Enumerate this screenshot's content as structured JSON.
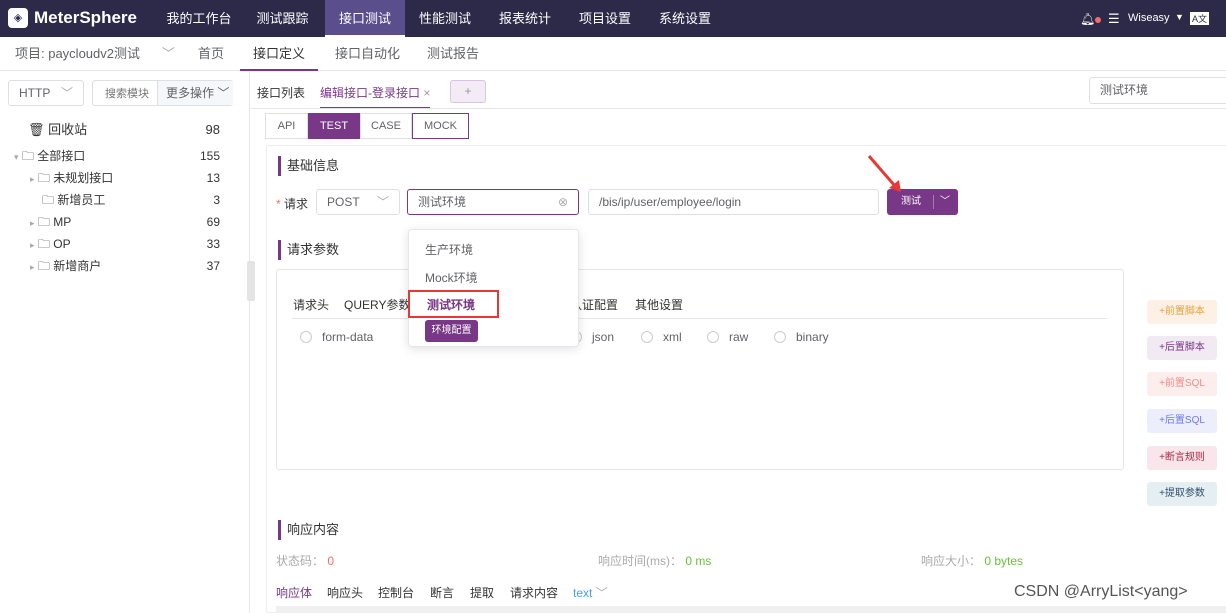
{
  "topbar": {
    "logo": "MeterSphere",
    "nav": [
      "我的工作台",
      "测试跟踪",
      "接口测试",
      "性能测试",
      "报表统计",
      "项目设置",
      "系统设置"
    ],
    "active": "接口测试",
    "user": "Wiseasy",
    "lang": "A文"
  },
  "subbar": {
    "project": "项目: paycloudv2测试",
    "items": [
      "首页",
      "接口定义",
      "接口自动化",
      "测试报告"
    ],
    "active": "接口定义"
  },
  "sidebar": {
    "protocol": "HTTP",
    "search_placeholder": "搜索模块",
    "more": "更多操作",
    "trash": {
      "label": "回收站",
      "count": "98"
    },
    "root": {
      "label": "全部接口",
      "count": "155"
    },
    "items": [
      {
        "label": "未规划接口",
        "count": "13"
      },
      {
        "label": "新增员工",
        "count": "3"
      },
      {
        "label": "MP",
        "count": "69"
      },
      {
        "label": "OP",
        "count": "33"
      },
      {
        "label": "新增商户",
        "count": "37"
      }
    ]
  },
  "tabs": {
    "list": "接口列表",
    "edit": "编辑接口-登录接口",
    "add": "+",
    "env_select": "测试环境"
  },
  "modes": [
    "API",
    "TEST",
    "CASE",
    "MOCK"
  ],
  "basic": {
    "title": "基础信息",
    "request_label": "请求",
    "method": "POST",
    "env": "测试环境",
    "url": "/bis/ip/user/employee/login",
    "test_btn": "测试"
  },
  "env_dropdown": {
    "options": [
      "生产环境",
      "Mock环境",
      "测试环境"
    ],
    "selected": "测试环境",
    "config_btn": "环境配置"
  },
  "params": {
    "title": "请求参数",
    "tabs": [
      "请求头",
      "QUERY参数",
      "认证配置",
      "其他设置"
    ],
    "body_types": [
      "form-data",
      "json",
      "xml",
      "raw",
      "binary"
    ]
  },
  "side_buttons": [
    "+前置脚本",
    "+后置脚本",
    "+前置SQL",
    "+后置SQL",
    "+断言规则",
    "+提取参数"
  ],
  "response": {
    "title": "响应内容",
    "status_label": "状态码：",
    "status": "0",
    "time_label": "响应时间(ms)：",
    "time": "0 ms",
    "size_label": "响应大小：",
    "size": "0 bytes",
    "tabs": [
      "响应体",
      "响应头",
      "控制台",
      "断言",
      "提取",
      "请求内容"
    ],
    "format": "text"
  },
  "watermark": "CSDN @ArryList<yang>"
}
